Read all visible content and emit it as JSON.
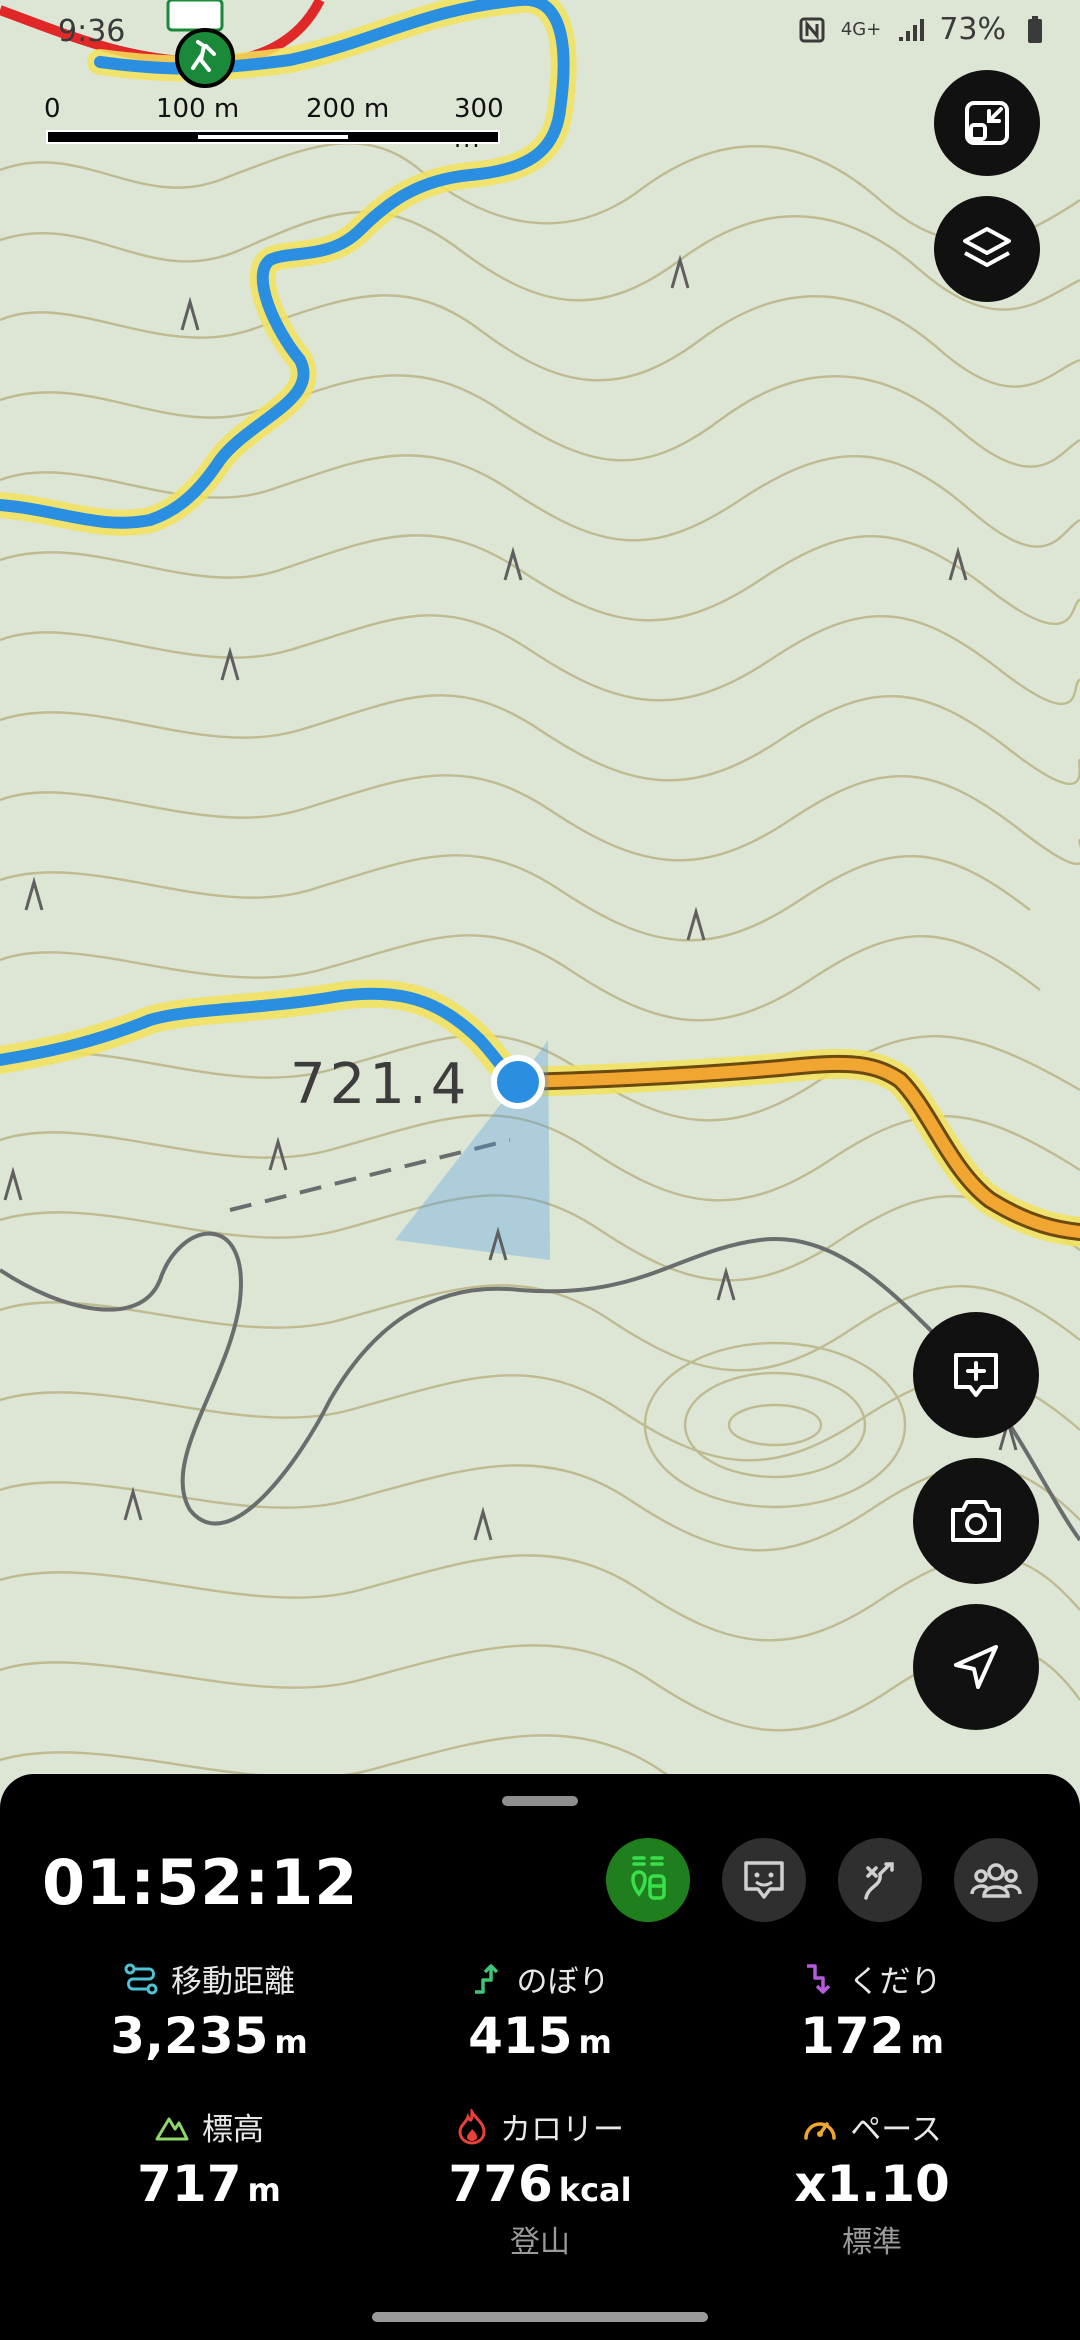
{
  "status_bar": {
    "time": "9:36",
    "battery": "73%",
    "network": "4G+"
  },
  "map": {
    "scale_labels": [
      "0",
      "100 m",
      "200 m",
      "300 m"
    ],
    "elevation_label": "721.4",
    "colors": {
      "route_blue": "#2a8fe0",
      "route_orange": "#f0a631",
      "highlight_yellow": "#f3e35a",
      "road_red": "#e02828",
      "contour": "#b9b486",
      "road_gray": "#6a6d6e"
    }
  },
  "panel": {
    "timer": "01:52:12",
    "tools": [
      {
        "icon": "hiker-pair-icon",
        "active": true
      },
      {
        "icon": "chat-face-icon",
        "active": false
      },
      {
        "icon": "route-branch-icon",
        "active": false
      },
      {
        "icon": "group-icon",
        "active": false
      }
    ],
    "stats": {
      "distance": {
        "label": "移動距離",
        "value": "3,235",
        "unit": "m",
        "color": "#4fc3d6"
      },
      "ascent": {
        "label": "のぼり",
        "value": "415",
        "unit": "m",
        "color": "#3fc47a"
      },
      "descent": {
        "label": "くだり",
        "value": "172",
        "unit": "m",
        "color": "#b55ad8"
      },
      "altitude": {
        "label": "標高",
        "value": "717",
        "unit": "m",
        "color": "#8fd66b"
      },
      "calories": {
        "label": "カロリー",
        "value": "776",
        "unit": "kcal",
        "sub": "登山",
        "color": "#e8403a"
      },
      "pace": {
        "label": "ペース",
        "value": "x1.10",
        "sub": "標準",
        "color": "#f0a72e"
      }
    }
  }
}
